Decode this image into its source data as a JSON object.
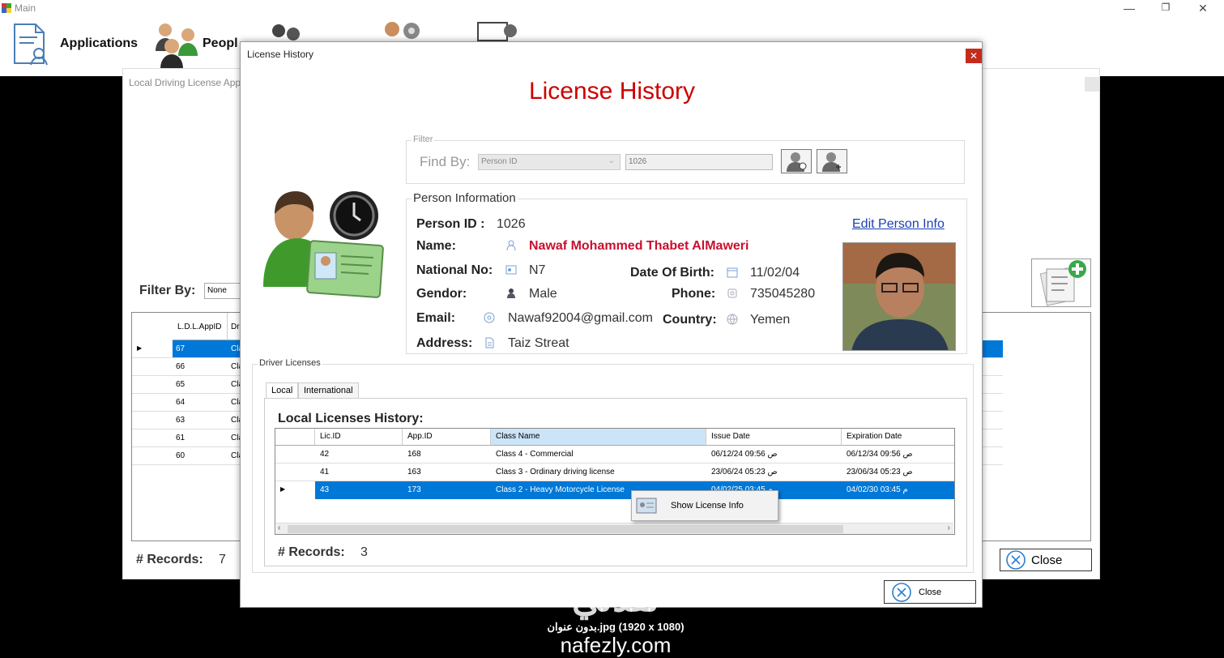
{
  "main_window": {
    "title": "Main",
    "toolbar": [
      {
        "label": "Applications",
        "icon": "applications-icon"
      },
      {
        "label": "Peopl",
        "icon": "people-icon"
      },
      {
        "label": "",
        "icon": "drivers-icon"
      },
      {
        "label": "",
        "icon": "users-icon"
      },
      {
        "label": "",
        "icon": "account-settings-icon"
      }
    ]
  },
  "background_form": {
    "title": "Local Driving License Appl",
    "filter_label": "Filter By:",
    "filter_value": "None",
    "grid_header": [
      "L.D.L.AppID",
      "Dr"
    ],
    "grid_rows": [
      {
        "id": "67",
        "c": "Cla"
      },
      {
        "id": "66",
        "c": "Cla"
      },
      {
        "id": "65",
        "c": "Cla"
      },
      {
        "id": "64",
        "c": "Cla"
      },
      {
        "id": "63",
        "c": "Cla"
      },
      {
        "id": "61",
        "c": "Cla"
      },
      {
        "id": "60",
        "c": "Cla"
      }
    ],
    "records_label": "# Records:",
    "records_value": "7",
    "close_label": "Close"
  },
  "dialog": {
    "title": "License History",
    "heading": "License History",
    "filter": {
      "group_title": "Filter",
      "find_by_label": "Find By:",
      "find_by_value": "Person ID",
      "search_value": "1026"
    },
    "person": {
      "group_title": "Person Information",
      "person_id_label": "Person ID :",
      "person_id": "1026",
      "edit_link": "Edit Person Info",
      "name_label": "Name:",
      "name": "Nawaf Mohammed Thabet AlMaweri",
      "national_no_label": "National No:",
      "national_no": "N7",
      "gender_label": "Gendor:",
      "gender": "Male",
      "email_label": "Email:",
      "email": "Nawaf92004@gmail.com",
      "address_label": "Address:",
      "address": "Taiz Streat",
      "dob_label": "Date Of Birth:",
      "dob": "11/02/04",
      "phone_label": "Phone:",
      "phone": "735045280",
      "country_label": "Country:",
      "country": "Yemen"
    },
    "licenses": {
      "group_title": "Driver Licenses",
      "tabs": [
        "Local",
        "International"
      ],
      "section_title": "Local Licenses History:",
      "columns": [
        "Lic.ID",
        "App.ID",
        "Class Name",
        "Issue Date",
        "Expiration Date"
      ],
      "rows": [
        [
          "42",
          "168",
          "Class 4 - Commercial",
          "06/12/24 09:56 ص",
          "06/12/34 09:56 ص"
        ],
        [
          "41",
          "163",
          "Class 3 - Ordinary driving license",
          "23/06/24 05:23 ص",
          "23/06/34 05:23 ص"
        ],
        [
          "43",
          "173",
          "Class 2 - Heavy Motorcycle License",
          "04/02/25 03:45 م",
          "04/02/30 03:45 م"
        ]
      ],
      "context_menu": "Show License Info",
      "records_label": "# Records:",
      "records_value": "3"
    },
    "close_label": "Close"
  },
  "watermark": {
    "arabic": "نفذلي",
    "filename": "بدون عنوان.jpg (1920 x 1080)",
    "site": "nafezly.com"
  }
}
